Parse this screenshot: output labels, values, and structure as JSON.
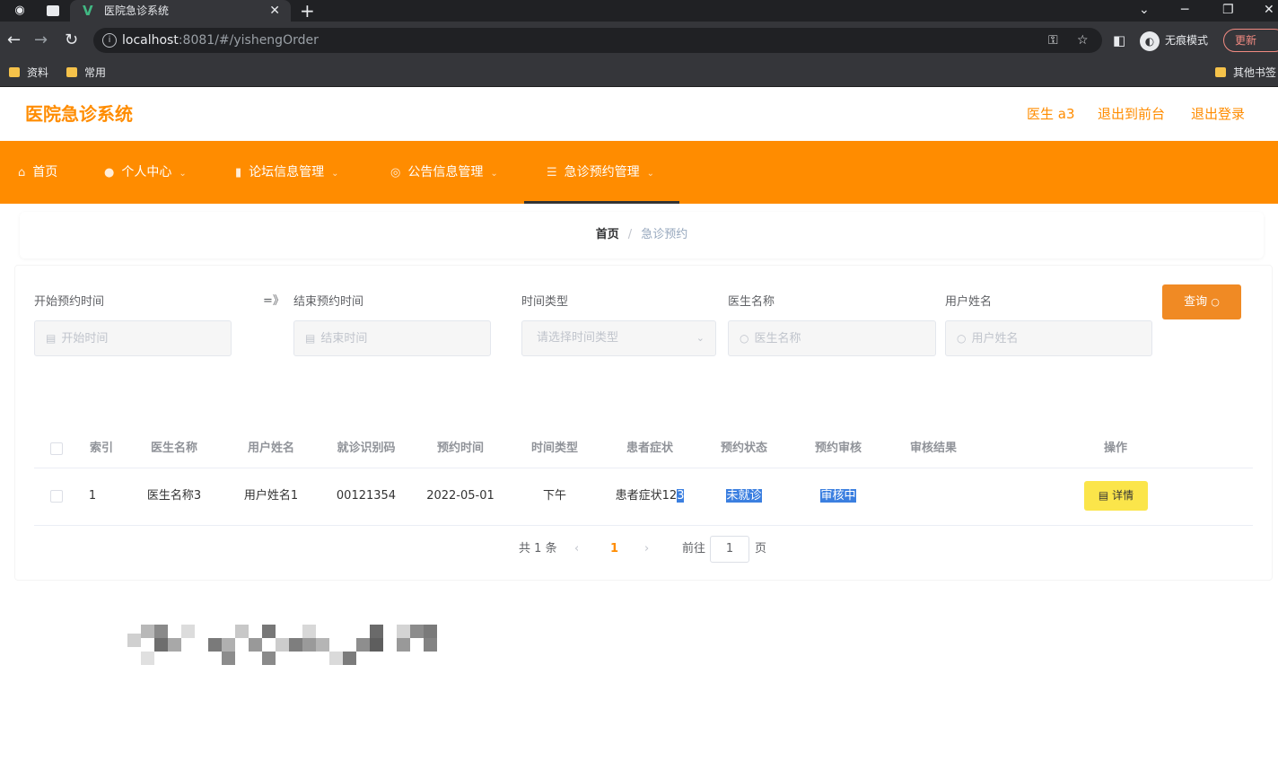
{
  "browser": {
    "tab_title": "医院急诊系统",
    "url_host": "localhost",
    "url_rest": ":8081/#/yishengOrder",
    "incognito_label": "无痕模式",
    "update_label": "更新",
    "bookmarks": [
      "资料",
      "常用"
    ],
    "other_bookmarks": "其他书签"
  },
  "header": {
    "brand": "医院急诊系统",
    "user": "医生 a3",
    "back_front": "退出到前台",
    "logout": "退出登录"
  },
  "nav": {
    "items": [
      {
        "label": "首页"
      },
      {
        "label": "个人中心"
      },
      {
        "label": "论坛信息管理"
      },
      {
        "label": "公告信息管理"
      },
      {
        "label": "急诊预约管理"
      }
    ],
    "active_index": 4
  },
  "breadcrumb": {
    "home": "首页",
    "separator": "/",
    "current": "急诊预约"
  },
  "filters": {
    "start_label": "开始预约时间",
    "start_placeholder": "开始时间",
    "range_arrow": "=》",
    "end_label": "结束预约时间",
    "end_placeholder": "结束时间",
    "type_label": "时间类型",
    "type_placeholder": "请选择时间类型",
    "doctor_label": "医生名称",
    "doctor_placeholder": "医生名称",
    "user_label": "用户姓名",
    "user_placeholder": "用户姓名",
    "query_button": "查询"
  },
  "table": {
    "headers": [
      "索引",
      "医生名称",
      "用户姓名",
      "就诊识别码",
      "预约时间",
      "时间类型",
      "患者症状",
      "预约状态",
      "预约审核",
      "审核结果",
      "操作"
    ],
    "rows": [
      {
        "index": "1",
        "doctor": "医生名称3",
        "user": "用户姓名1",
        "code": "00121354",
        "date": "2022-05-01",
        "time_type": "下午",
        "symptom_a": "患者症状12",
        "symptom_b": "3",
        "status": "未就诊",
        "review": "审核中",
        "result": "",
        "action": "详情"
      }
    ]
  },
  "pagination": {
    "total_prefix": "共",
    "total": "1",
    "total_suffix": "条",
    "current_page": "1",
    "goto_label": "前往",
    "goto_value": "1",
    "page_suffix": "页"
  },
  "colors": {
    "brand": "#ff8c00",
    "query_button": "#f08a24",
    "detail_button": "#fbe54a",
    "highlight": "#3b7fe0"
  }
}
